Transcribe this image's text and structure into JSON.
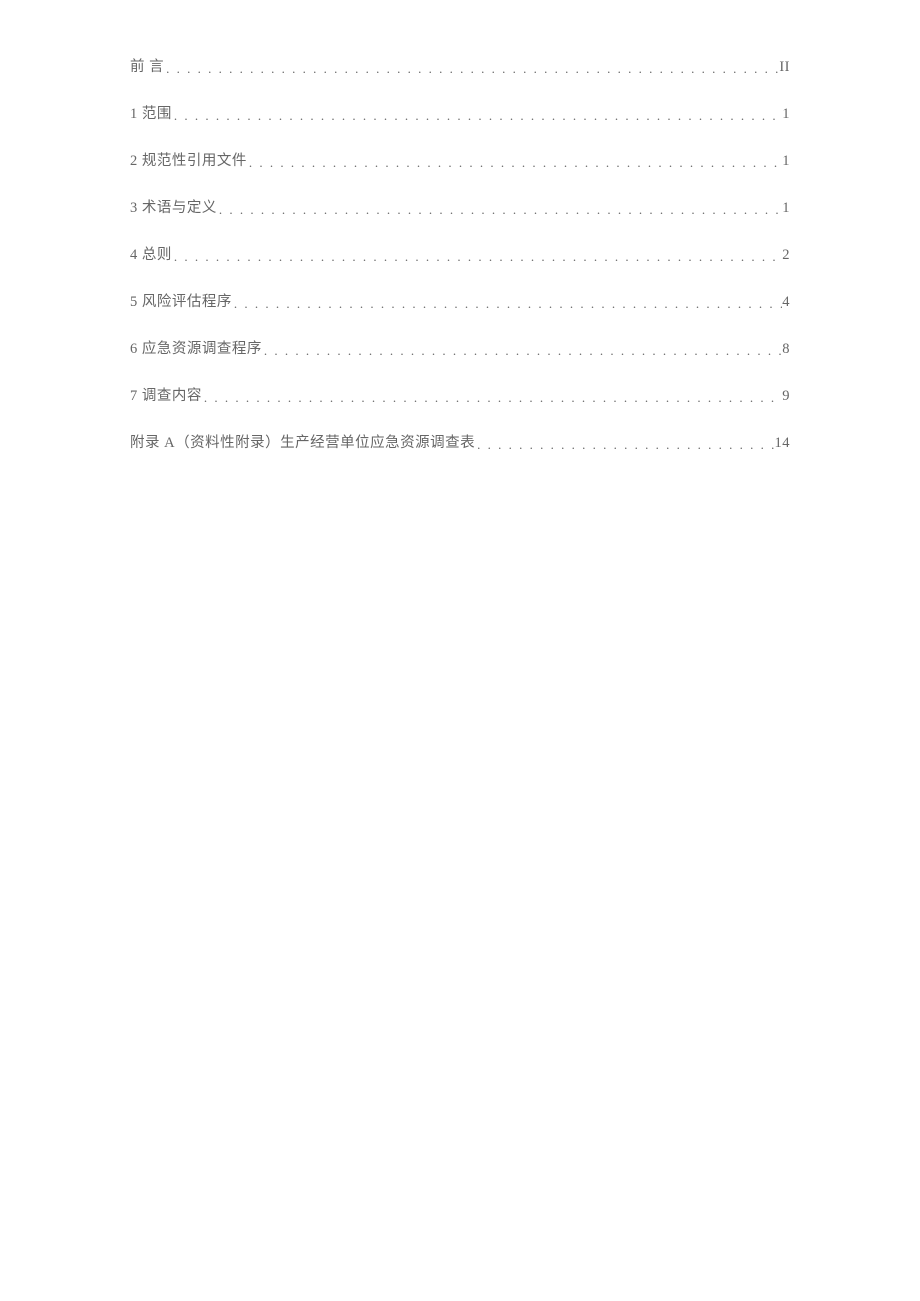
{
  "toc": {
    "dots": ". . . . . . . . . . . . . . . . . . . . . . . . . . . . . . . . . . . . . . . . . . . . . . . . . . . . . . . . . . . . . . . . . . . . . . . . . . . . . . . . . . . . . . . . . . . . . . . . . . . . . . . . . . . . . . . . . . . . . . . . . . . . . . . . . . . . . . . . . . . . . . . . . . . . . . . . . . . . . . . . . . . . . . . . . . . . . . . . . . . . . . . . . . . . . . . . . . . .",
    "entries": [
      {
        "title": "前 言",
        "page": "II",
        "spaced": false
      },
      {
        "title": "1 范围",
        "page": "1",
        "spaced": false
      },
      {
        "title": "2 规范性引用文件",
        "page": "1",
        "spaced": false
      },
      {
        "title": "3 术语与定义",
        "page": "1",
        "spaced": false
      },
      {
        "title": "4 总则",
        "page": "2",
        "spaced": false
      },
      {
        "title": "5 风险评估程序",
        "page": "4",
        "spaced": false
      },
      {
        "title": "6 应急资源调查程序",
        "page": "8",
        "spaced": false
      },
      {
        "title": "7 调查内容",
        "page": "9",
        "spaced": false
      },
      {
        "title": "附录 A（资料性附录）生产经营单位应急资源调查表",
        "page": "14",
        "spaced": false
      }
    ]
  }
}
